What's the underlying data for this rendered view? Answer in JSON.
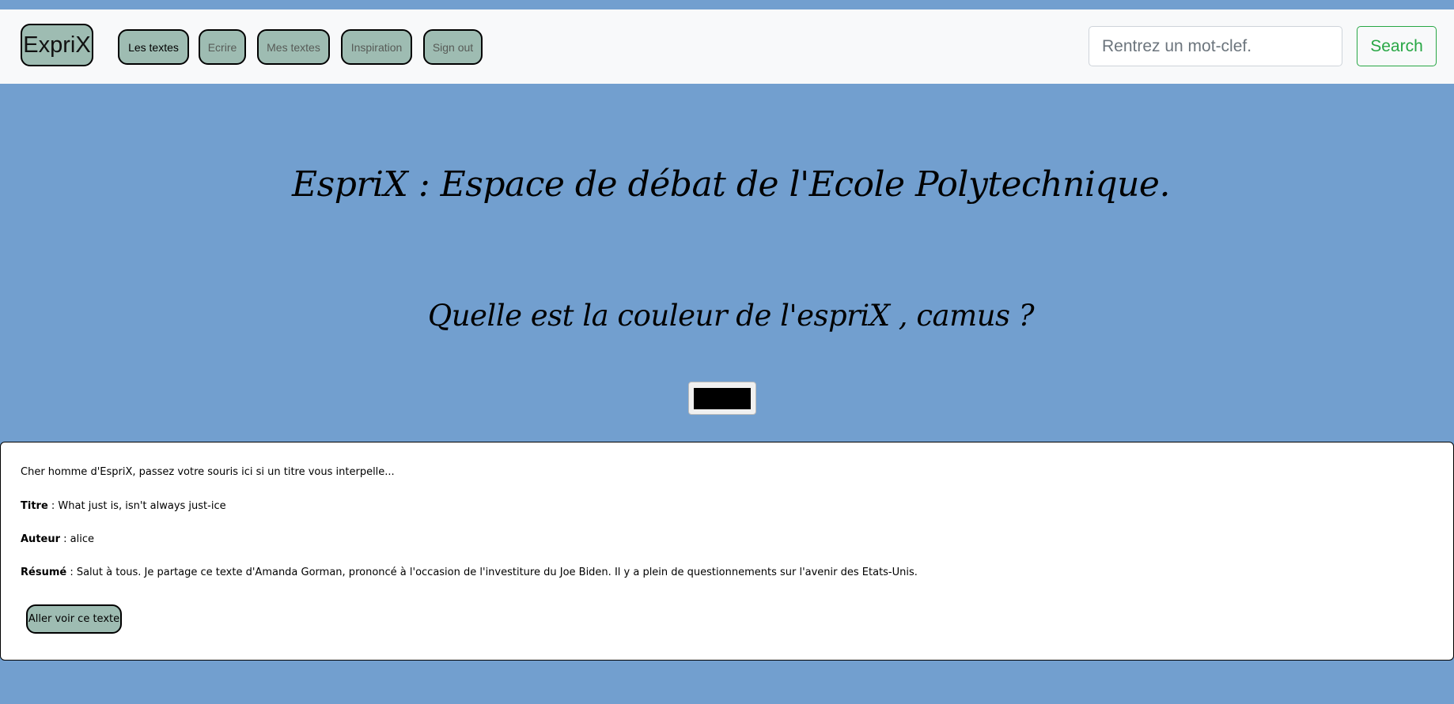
{
  "navbar": {
    "brand": "ExpriX",
    "items": [
      {
        "label": "Les textes"
      },
      {
        "label": "Ecrire"
      },
      {
        "label": "Mes textes"
      },
      {
        "label": "Inspiration"
      },
      {
        "label": "Sign out"
      }
    ],
    "search_placeholder": "Rentrez un mot-clef.",
    "search_value": "",
    "search_button": "Search"
  },
  "hero": {
    "title": "EspriX : Espace de débat de l'Ecole Polytechnique.",
    "subtitle": "Quelle est la couleur de l'espriX , camus ?",
    "color_value": "#000000"
  },
  "card": {
    "intro": "Cher homme d'EspriX, passez votre souris ici si un titre vous interpelle...",
    "title_label": "Titre",
    "title_value": " : What just is, isn't always just-ice",
    "author_label": "Auteur",
    "author_value": " : alice",
    "summary_label": "Résumé",
    "summary_value": " : Salut à tous. Je partage ce texte d'Amanda Gorman, prononcé à l'occasion de l'investiture du Joe Biden. Il y a plein de questionnements sur l'avenir des Etats-Unis.",
    "button": "Aller voir ce texte"
  },
  "colors": {
    "background": "#729fcf",
    "navbar_bg": "#f8f9fa",
    "button_bg": "#9ebcb2",
    "search_accent": "#28a745"
  }
}
